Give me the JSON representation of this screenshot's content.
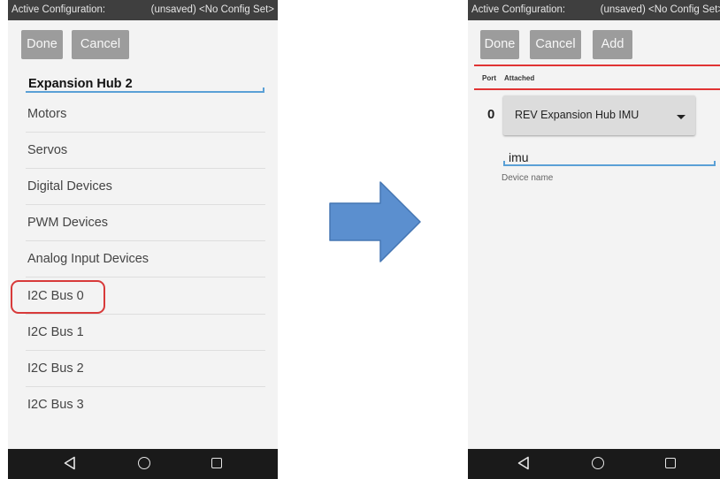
{
  "left_screen": {
    "status_bar": {
      "label": "Active Configuration:",
      "value": "(unsaved) <No Config Set>"
    },
    "buttons": {
      "done": "Done",
      "cancel": "Cancel"
    },
    "hub_name": "Expansion Hub 2",
    "items": [
      "Motors",
      "Servos",
      "Digital Devices",
      "PWM Devices",
      "Analog Input Devices",
      "I2C Bus 0",
      "I2C Bus 1",
      "I2C Bus 2",
      "I2C Bus 3"
    ],
    "highlighted_item": "I2C Bus 0"
  },
  "right_screen": {
    "status_bar": {
      "label": "Active Configuration:",
      "value": "(unsaved) <No Config Set>"
    },
    "buttons": {
      "done": "Done",
      "cancel": "Cancel",
      "add": "Add"
    },
    "table_headers": {
      "port": "Port",
      "attached": "Attached"
    },
    "port": "0",
    "device_type": "REV Expansion Hub IMU",
    "device_name": "imu",
    "device_name_hint": "Device name"
  },
  "nav_bar": {
    "icons": [
      "back-icon",
      "home-icon",
      "recent-apps-icon"
    ]
  },
  "colors": {
    "status_bar": "#3f3f3f",
    "button": "#9c9c9c",
    "highlight": "#d83a3a",
    "accent_underline": "#5aa0d6",
    "arrow": "#5b8fcf",
    "nav_bar": "#1a1a1a"
  }
}
